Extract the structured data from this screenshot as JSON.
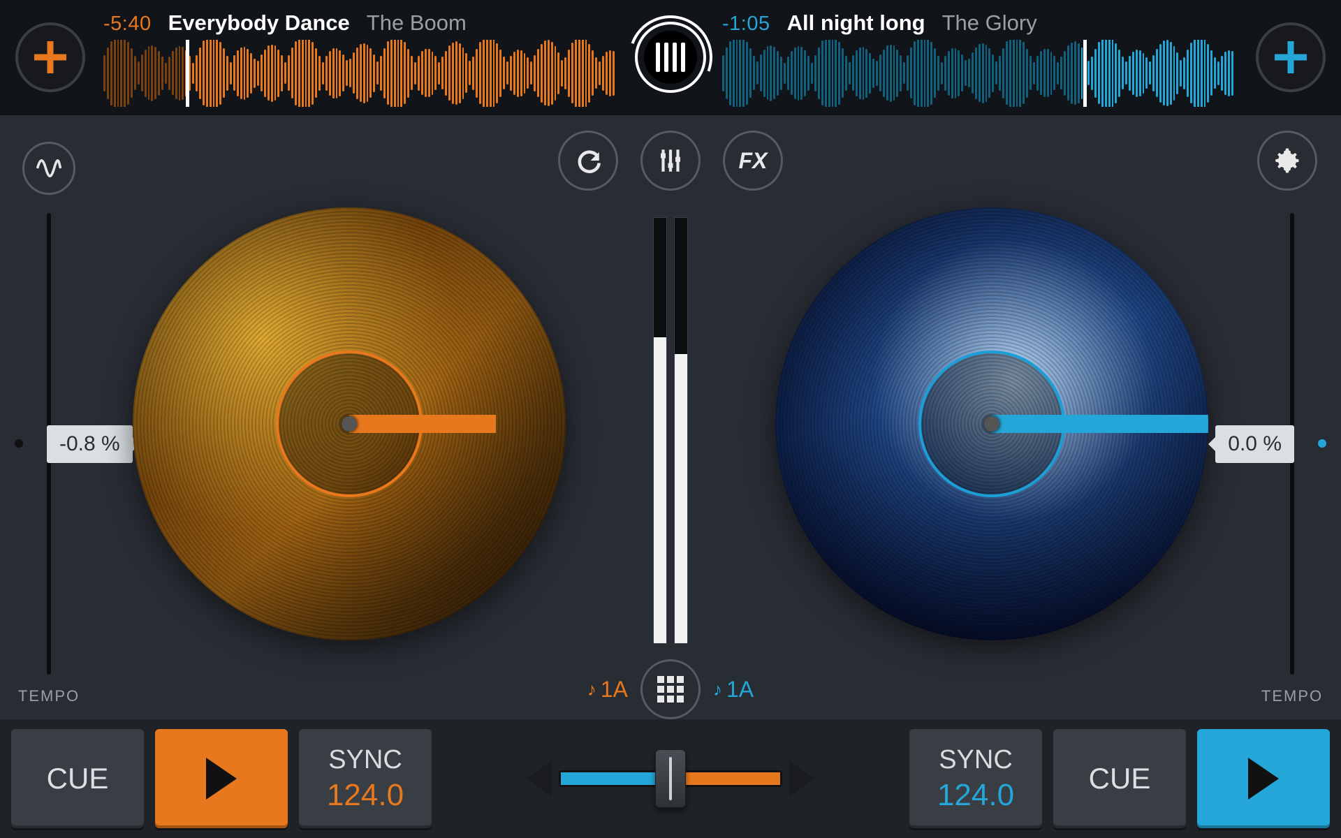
{
  "colors": {
    "orange": "#e8781e",
    "blue": "#24a6d8",
    "panel": "#282c33",
    "darkpanel": "#111418"
  },
  "deckA": {
    "add_label": "+",
    "time_remaining": "-5:40",
    "title": "Everybody Dance",
    "artist": "The Boom",
    "tempo_percent": "-0.8 %",
    "tempo_label": "TEMPO",
    "key": "1A",
    "cue": "CUE",
    "sync": "SYNC",
    "bpm": "124.0"
  },
  "deckB": {
    "add_label": "+",
    "time_remaining": "-1:05",
    "title": "All night long",
    "artist": "The Glory",
    "tempo_percent": "0.0 %",
    "tempo_label": "TEMPO",
    "key": "1A",
    "cue": "CUE",
    "sync": "SYNC",
    "bpm": "124.0"
  },
  "center": {
    "loop_label": "loop",
    "mixer_label": "mixer",
    "fx_label": "FX",
    "sampler_label": "sampler"
  },
  "icons": {
    "wave": "wave-icon",
    "gear": "gear-icon",
    "loop": "loop-icon",
    "mixer": "mixer-sliders-icon",
    "fx": "fx-icon",
    "sampler": "sampler-grid-icon",
    "library": "library-bars-icon"
  }
}
